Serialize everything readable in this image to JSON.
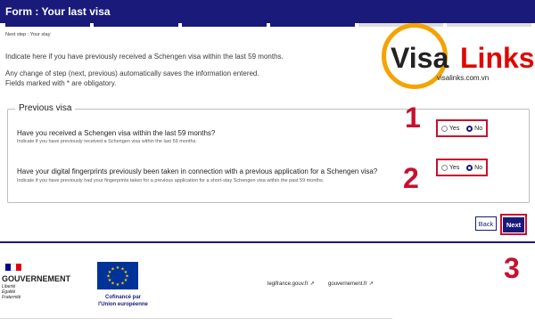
{
  "header": {
    "title": "Form : Your last visa",
    "next_step": "Next step : Your stay",
    "step_count": 6,
    "steps_done": 4
  },
  "intro": {
    "line1": "Indicate here if you have previously received a Schengen visa within the last 59 months.",
    "line2": "Any change of step (next, previous) automatically saves the information entered.",
    "line3": "Fields marked with * are obligatory."
  },
  "section": {
    "legend": "Previous visa",
    "q1": {
      "label": "Have you received a Schengen visa within the last 59 months?",
      "hint": "Indicate if you have previously received a Schengen visa within the last 59 months.",
      "yes": "Yes",
      "no": "No",
      "selected": "No"
    },
    "q2": {
      "label": "Have your digital fingerprints previously been taken in connection with a previous application for a Schengen visa?",
      "hint": "Indicate if you have previously had your fingerprints taken for a previous application for a short-stay Schengen visa within the past 59 months.",
      "yes": "Yes",
      "no": "No",
      "selected": "No"
    }
  },
  "annotations": {
    "n1": "1",
    "n2": "2",
    "n3": "3",
    "color": "#c8102e"
  },
  "buttons": {
    "back": "Back",
    "next": "Next"
  },
  "footer": {
    "gov": "GOUVERNEMENT",
    "motto1": "Liberté",
    "motto2": "Égalité",
    "motto3": "Fraternité",
    "eu_caption1": "Cofinancé par",
    "eu_caption2": "l'Union européenne",
    "link1": "legifrance.gouv.fr",
    "link2": "gouvernement.fr"
  },
  "watermark": {
    "visa": "Visa",
    "links": "Links",
    "url": "visalinks.com.vn"
  },
  "colors": {
    "navy": "#1a1a7a",
    "red": "#c8102e",
    "accent_orange": "#f4a300"
  }
}
